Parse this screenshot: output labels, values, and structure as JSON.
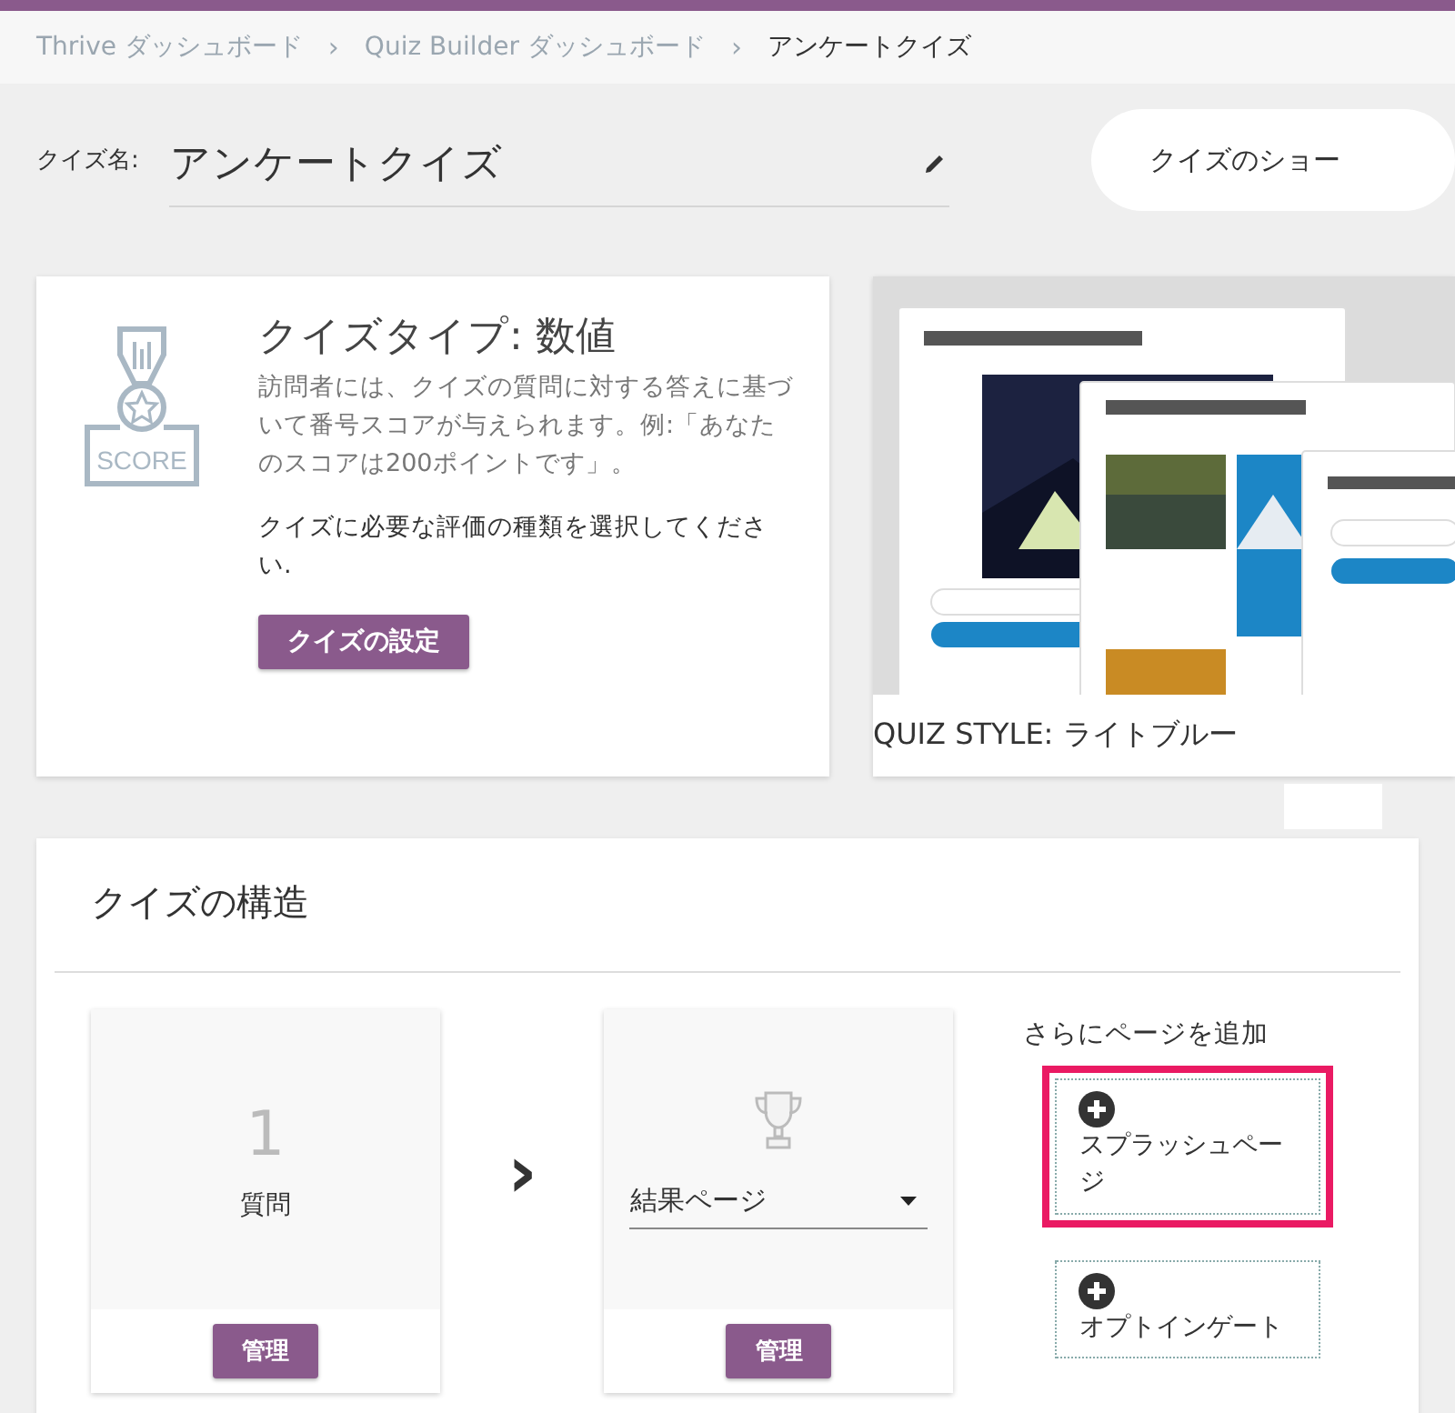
{
  "breadcrumbs": [
    {
      "label": "Thrive ダッシュボード",
      "current": false
    },
    {
      "label": "Quiz Builder ダッシュボード",
      "current": false
    },
    {
      "label": "アンケートクイズ",
      "current": true
    }
  ],
  "breadcrumb_separator": "›",
  "quiz_name": {
    "label": "クイズ名:",
    "value": "アンケートクイズ"
  },
  "show_button": {
    "label": "クイズのショー"
  },
  "quiz_type": {
    "title": "クイズタイプ: 数値",
    "description": "訪問者には、クイズの質問に対する答えに基づいて番号スコアが与えられます。例:「あなたのスコアは200ポイントです」。",
    "prompt": "クイズに必要な評価の種類を選択してください.",
    "icon_label": "SCORE",
    "button": "クイズの設定"
  },
  "quiz_style": {
    "kind": "picture",
    "caption": "QUIZ STYLE: ライトブルー"
  },
  "structure": {
    "title": "クイズの構造",
    "question_card": {
      "count": "1",
      "label": "質問",
      "button": "管理"
    },
    "arrow": "›",
    "results_card": {
      "select_value": "結果ページ",
      "button": "管理"
    },
    "add_pages": {
      "title": "さらにページを追加",
      "items": [
        {
          "label": "スプラッシュページ",
          "highlighted": true
        },
        {
          "label": "オプトインゲート",
          "highlighted": false
        }
      ]
    }
  }
}
